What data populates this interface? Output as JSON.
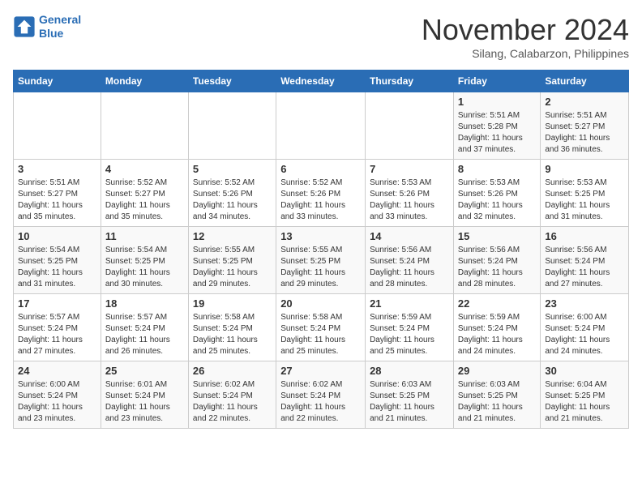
{
  "header": {
    "logo_line1": "General",
    "logo_line2": "Blue",
    "month": "November 2024",
    "location": "Silang, Calabarzon, Philippines"
  },
  "weekdays": [
    "Sunday",
    "Monday",
    "Tuesday",
    "Wednesday",
    "Thursday",
    "Friday",
    "Saturday"
  ],
  "weeks": [
    [
      {
        "day": "",
        "info": ""
      },
      {
        "day": "",
        "info": ""
      },
      {
        "day": "",
        "info": ""
      },
      {
        "day": "",
        "info": ""
      },
      {
        "day": "",
        "info": ""
      },
      {
        "day": "1",
        "info": "Sunrise: 5:51 AM\nSunset: 5:28 PM\nDaylight: 11 hours\nand 37 minutes."
      },
      {
        "day": "2",
        "info": "Sunrise: 5:51 AM\nSunset: 5:27 PM\nDaylight: 11 hours\nand 36 minutes."
      }
    ],
    [
      {
        "day": "3",
        "info": "Sunrise: 5:51 AM\nSunset: 5:27 PM\nDaylight: 11 hours\nand 35 minutes."
      },
      {
        "day": "4",
        "info": "Sunrise: 5:52 AM\nSunset: 5:27 PM\nDaylight: 11 hours\nand 35 minutes."
      },
      {
        "day": "5",
        "info": "Sunrise: 5:52 AM\nSunset: 5:26 PM\nDaylight: 11 hours\nand 34 minutes."
      },
      {
        "day": "6",
        "info": "Sunrise: 5:52 AM\nSunset: 5:26 PM\nDaylight: 11 hours\nand 33 minutes."
      },
      {
        "day": "7",
        "info": "Sunrise: 5:53 AM\nSunset: 5:26 PM\nDaylight: 11 hours\nand 33 minutes."
      },
      {
        "day": "8",
        "info": "Sunrise: 5:53 AM\nSunset: 5:26 PM\nDaylight: 11 hours\nand 32 minutes."
      },
      {
        "day": "9",
        "info": "Sunrise: 5:53 AM\nSunset: 5:25 PM\nDaylight: 11 hours\nand 31 minutes."
      }
    ],
    [
      {
        "day": "10",
        "info": "Sunrise: 5:54 AM\nSunset: 5:25 PM\nDaylight: 11 hours\nand 31 minutes."
      },
      {
        "day": "11",
        "info": "Sunrise: 5:54 AM\nSunset: 5:25 PM\nDaylight: 11 hours\nand 30 minutes."
      },
      {
        "day": "12",
        "info": "Sunrise: 5:55 AM\nSunset: 5:25 PM\nDaylight: 11 hours\nand 29 minutes."
      },
      {
        "day": "13",
        "info": "Sunrise: 5:55 AM\nSunset: 5:25 PM\nDaylight: 11 hours\nand 29 minutes."
      },
      {
        "day": "14",
        "info": "Sunrise: 5:56 AM\nSunset: 5:24 PM\nDaylight: 11 hours\nand 28 minutes."
      },
      {
        "day": "15",
        "info": "Sunrise: 5:56 AM\nSunset: 5:24 PM\nDaylight: 11 hours\nand 28 minutes."
      },
      {
        "day": "16",
        "info": "Sunrise: 5:56 AM\nSunset: 5:24 PM\nDaylight: 11 hours\nand 27 minutes."
      }
    ],
    [
      {
        "day": "17",
        "info": "Sunrise: 5:57 AM\nSunset: 5:24 PM\nDaylight: 11 hours\nand 27 minutes."
      },
      {
        "day": "18",
        "info": "Sunrise: 5:57 AM\nSunset: 5:24 PM\nDaylight: 11 hours\nand 26 minutes."
      },
      {
        "day": "19",
        "info": "Sunrise: 5:58 AM\nSunset: 5:24 PM\nDaylight: 11 hours\nand 25 minutes."
      },
      {
        "day": "20",
        "info": "Sunrise: 5:58 AM\nSunset: 5:24 PM\nDaylight: 11 hours\nand 25 minutes."
      },
      {
        "day": "21",
        "info": "Sunrise: 5:59 AM\nSunset: 5:24 PM\nDaylight: 11 hours\nand 25 minutes."
      },
      {
        "day": "22",
        "info": "Sunrise: 5:59 AM\nSunset: 5:24 PM\nDaylight: 11 hours\nand 24 minutes."
      },
      {
        "day": "23",
        "info": "Sunrise: 6:00 AM\nSunset: 5:24 PM\nDaylight: 11 hours\nand 24 minutes."
      }
    ],
    [
      {
        "day": "24",
        "info": "Sunrise: 6:00 AM\nSunset: 5:24 PM\nDaylight: 11 hours\nand 23 minutes."
      },
      {
        "day": "25",
        "info": "Sunrise: 6:01 AM\nSunset: 5:24 PM\nDaylight: 11 hours\nand 23 minutes."
      },
      {
        "day": "26",
        "info": "Sunrise: 6:02 AM\nSunset: 5:24 PM\nDaylight: 11 hours\nand 22 minutes."
      },
      {
        "day": "27",
        "info": "Sunrise: 6:02 AM\nSunset: 5:24 PM\nDaylight: 11 hours\nand 22 minutes."
      },
      {
        "day": "28",
        "info": "Sunrise: 6:03 AM\nSunset: 5:25 PM\nDaylight: 11 hours\nand 21 minutes."
      },
      {
        "day": "29",
        "info": "Sunrise: 6:03 AM\nSunset: 5:25 PM\nDaylight: 11 hours\nand 21 minutes."
      },
      {
        "day": "30",
        "info": "Sunrise: 6:04 AM\nSunset: 5:25 PM\nDaylight: 11 hours\nand 21 minutes."
      }
    ]
  ]
}
